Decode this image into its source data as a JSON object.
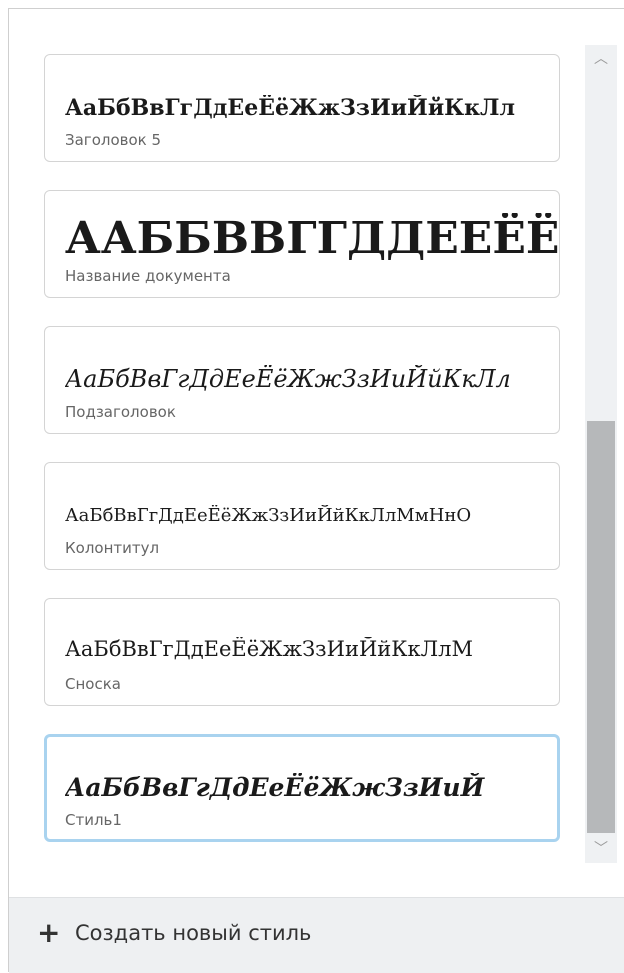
{
  "styles": [
    {
      "preview": "АаБбВвГгДдЕеЁёЖжЗзИиЙйКкЛл",
      "label": "Заголовок 5"
    },
    {
      "preview": "ААББВВГГДДЕЕЁЁЖЖ",
      "label": "Название документа"
    },
    {
      "preview": "АаБбВвГгДдЕеЁёЖжЗзИиЙйКкЛл",
      "label": "Подзаголовок"
    },
    {
      "preview": "АаБбВвГгДдЕеЁёЖжЗзИиЙйКкЛлМмНнО",
      "label": "Колонтитул"
    },
    {
      "preview": "АаБбВвГгДдЕеЁёЖжЗзИиЙйКкЛлМ",
      "label": "Сноска"
    },
    {
      "preview": "АаБбВвГгДдЕеЁёЖжЗзИиЙ",
      "label": "Стиль1",
      "selected": true
    }
  ],
  "footer": {
    "plus_icon": "plus-icon",
    "create_label": "Создать новый стиль"
  },
  "scrollbar": {
    "up_icon": "chevron-up-icon",
    "down_icon": "chevron-down-icon"
  },
  "colors": {
    "selected_border": "#a9d3ef",
    "footer_bg": "#eef0f2",
    "thumb": "#b6b8ba"
  }
}
